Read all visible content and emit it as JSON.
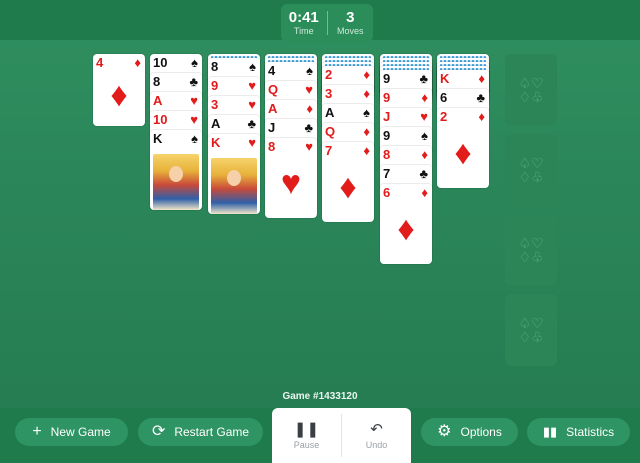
{
  "hud": {
    "time_value": "0:41",
    "time_label": "Time",
    "moves_value": "3",
    "moves_label": "Moves"
  },
  "waste": {
    "rank": "4",
    "suit": "♦",
    "color": "red"
  },
  "tableau": [
    {
      "cards": [
        {
          "rank": "10",
          "suit": "♠",
          "color": "black"
        },
        {
          "rank": "8",
          "suit": "♣",
          "color": "black"
        },
        {
          "rank": "A",
          "suit": "♥",
          "color": "red"
        },
        {
          "rank": "10",
          "suit": "♥",
          "color": "red"
        },
        {
          "rank": "K",
          "suit": "♠",
          "color": "black"
        }
      ]
    },
    {
      "cards": [
        {
          "rank": "8",
          "suit": "♠",
          "color": "black"
        },
        {
          "rank": "9",
          "suit": "♥",
          "color": "red"
        },
        {
          "rank": "3",
          "suit": "♥",
          "color": "red"
        },
        {
          "rank": "A",
          "suit": "♣",
          "color": "black"
        },
        {
          "rank": "K",
          "suit": "♥",
          "color": "red"
        }
      ]
    },
    {
      "cards": [
        {
          "rank": "4",
          "suit": "♠",
          "color": "black"
        },
        {
          "rank": "Q",
          "suit": "♥",
          "color": "red"
        },
        {
          "rank": "A",
          "suit": "♦",
          "color": "red"
        },
        {
          "rank": "J",
          "suit": "♣",
          "color": "black"
        },
        {
          "rank": "8",
          "suit": "♥",
          "color": "red"
        }
      ]
    },
    {
      "cards": [
        {
          "rank": "2",
          "suit": "♦",
          "color": "red"
        },
        {
          "rank": "3",
          "suit": "♦",
          "color": "red"
        },
        {
          "rank": "A",
          "suit": "♠",
          "color": "black"
        },
        {
          "rank": "Q",
          "suit": "♦",
          "color": "red"
        },
        {
          "rank": "7",
          "suit": "♦",
          "color": "red"
        }
      ]
    },
    {
      "cards": [
        {
          "rank": "9",
          "suit": "♣",
          "color": "black"
        },
        {
          "rank": "9",
          "suit": "♦",
          "color": "red"
        },
        {
          "rank": "J",
          "suit": "♥",
          "color": "red"
        },
        {
          "rank": "9",
          "suit": "♠",
          "color": "black"
        },
        {
          "rank": "8",
          "suit": "♦",
          "color": "red"
        },
        {
          "rank": "7",
          "suit": "♣",
          "color": "black"
        },
        {
          "rank": "6",
          "suit": "♦",
          "color": "red"
        }
      ]
    },
    {
      "cards": [
        {
          "rank": "K",
          "suit": "♦",
          "color": "red"
        },
        {
          "rank": "6",
          "suit": "♣",
          "color": "black"
        },
        {
          "rank": "2",
          "suit": "♦",
          "color": "red"
        }
      ]
    }
  ],
  "foundation_symbol": "♤♡\n♢♧",
  "game_number": "Game #1433120",
  "toolbar": {
    "new_game": "New Game",
    "restart_game": "Restart Game",
    "pause": "Pause",
    "undo": "Undo",
    "options": "Options",
    "statistics": "Statistics"
  },
  "icons": {
    "new_game": "plus-icon",
    "restart_game": "refresh-icon",
    "pause": "pause-icon",
    "undo": "undo-icon",
    "options": "gear-icon",
    "statistics": "bar-chart-icon"
  },
  "colors": {
    "felt": "#2a8558",
    "bar": "#1f7a4c",
    "button": "#2f9463",
    "red": "#e21b1b"
  }
}
